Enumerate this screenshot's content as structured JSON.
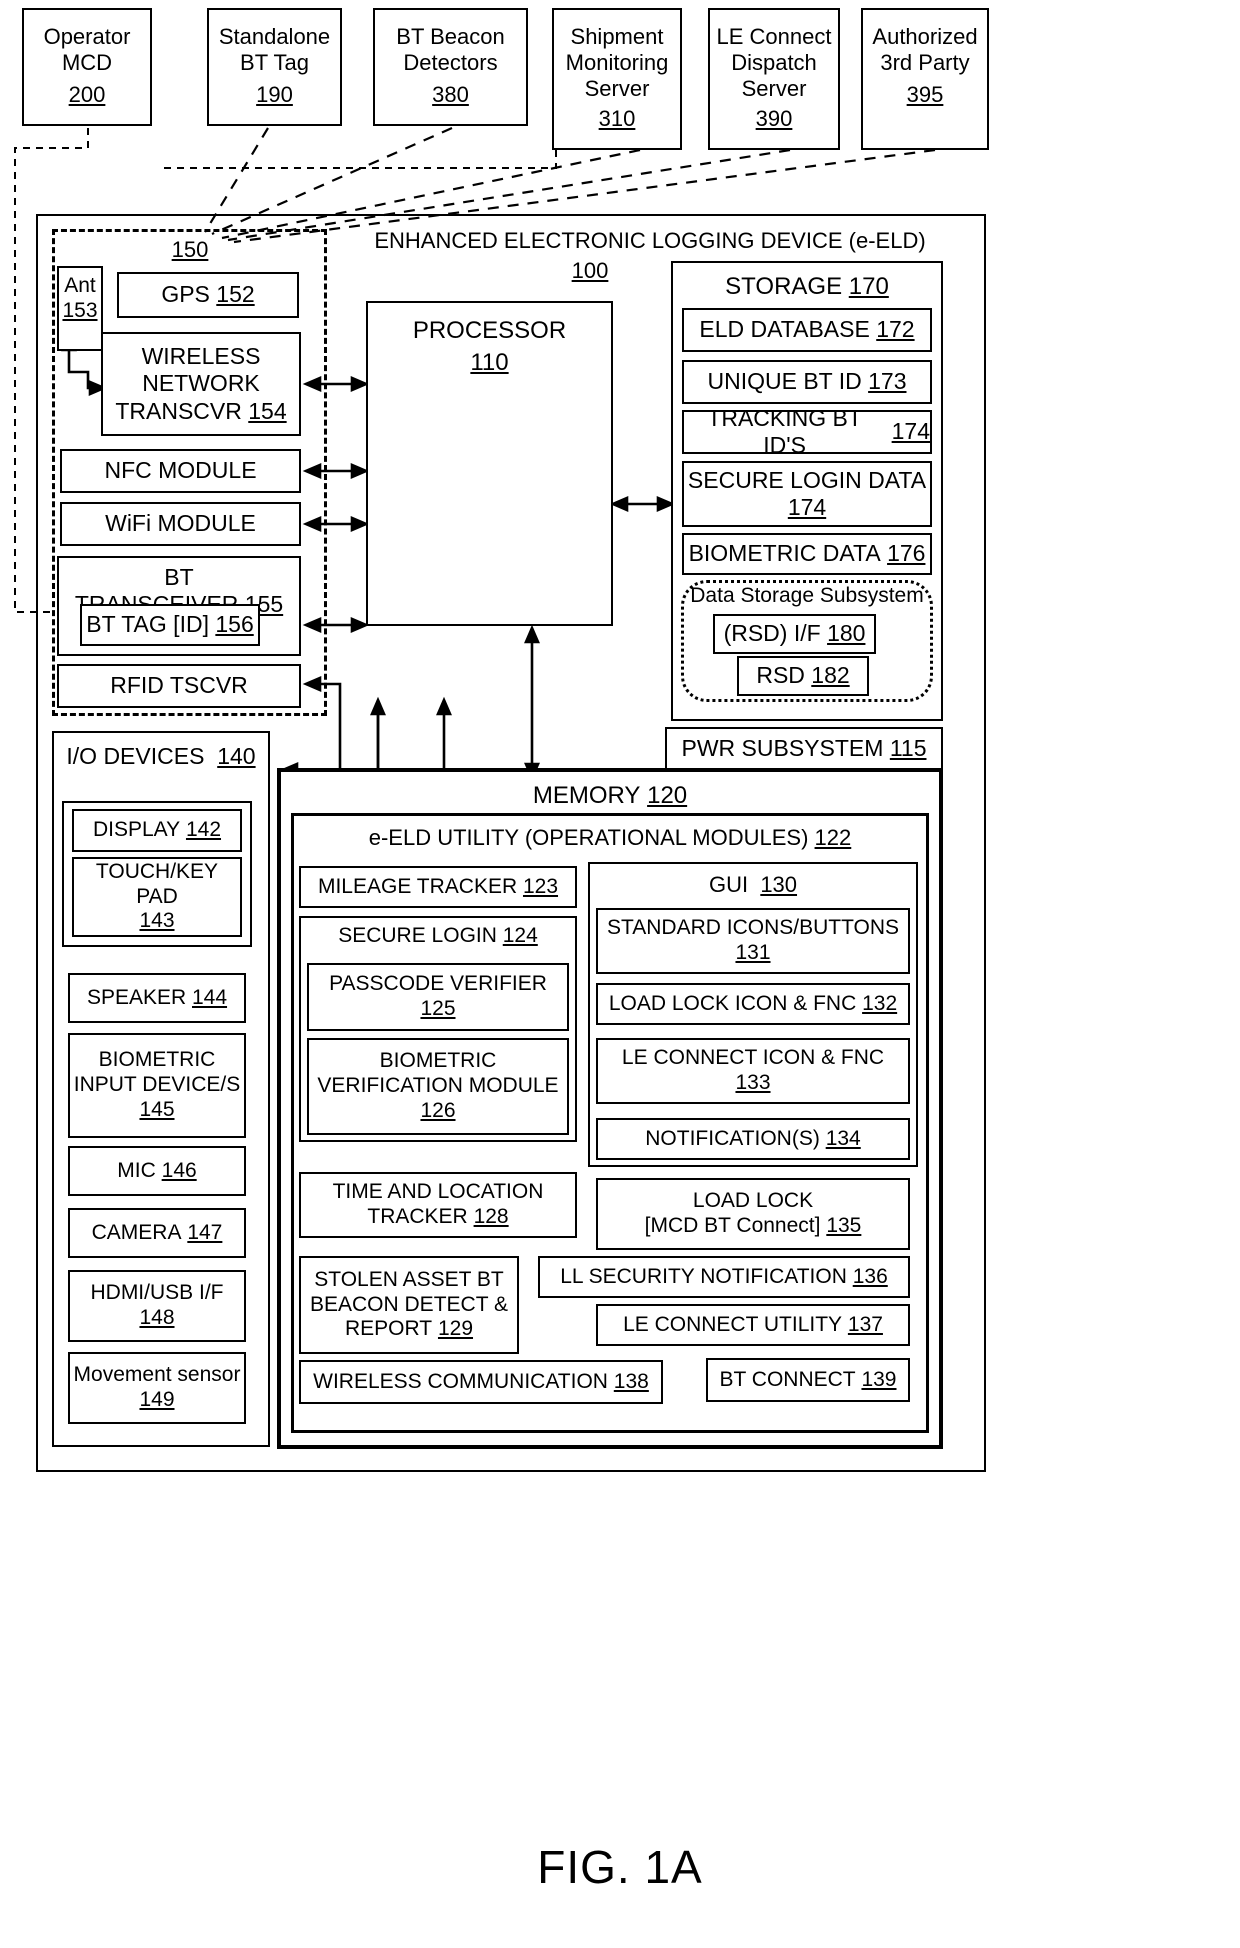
{
  "figure": {
    "caption": "FIG. 1A"
  },
  "external_nodes": [
    {
      "lines": [
        "Operator",
        "MCD"
      ],
      "ref": "200"
    },
    {
      "lines": [
        "Standalone",
        "BT Tag"
      ],
      "ref": "190"
    },
    {
      "lines": [
        "BT Beacon",
        "Detectors"
      ],
      "ref": "380"
    },
    {
      "lines": [
        "Shipment",
        "Monitoring",
        "Server"
      ],
      "ref": "310"
    },
    {
      "lines": [
        "LE Connect",
        "Dispatch",
        "Server"
      ],
      "ref": "390"
    },
    {
      "lines": [
        "Authorized",
        "3rd Party"
      ],
      "ref": "395"
    }
  ],
  "device": {
    "title": "ENHANCED ELECTRONIC LOGGING DEVICE (e-ELD)",
    "ref": "100"
  },
  "comms_group": {
    "ref": "150"
  },
  "comms": {
    "antenna": {
      "label": "Ant",
      "ref": "153"
    },
    "gps": {
      "label": "GPS",
      "ref": "152"
    },
    "wireless_network": {
      "lines": [
        "WIRELESS",
        "NETWORK",
        "TRANSCVR"
      ],
      "ref": "154"
    },
    "nfc": {
      "label": "NFC MODULE",
      "ref": ""
    },
    "wifi": {
      "label": "WiFi MODULE",
      "ref": ""
    },
    "bt_transceiver": {
      "label": "BT TRANSCEIVER",
      "ref": "155"
    },
    "bt_tag": {
      "label": "BT TAG [ID]",
      "ref": "156"
    },
    "rfid": {
      "label": "RFID TSCVR",
      "ref": ""
    }
  },
  "processor": {
    "label": "PROCESSOR",
    "ref": "110"
  },
  "storage": {
    "title": "STORAGE",
    "ref": "170",
    "items": [
      {
        "label": "ELD DATABASE",
        "ref": "172"
      },
      {
        "label": "UNIQUE BT ID",
        "ref": "173"
      },
      {
        "label": "TRACKING BT ID'S",
        "ref": "174"
      },
      {
        "label": "SECURE LOGIN DATA",
        "ref": "174",
        "two_line": true
      },
      {
        "label": "BIOMETRIC DATA",
        "ref": "176"
      }
    ],
    "subsystem": {
      "title": "Data Storage Subsystem",
      "rsd_if": {
        "label": "(RSD) I/F",
        "ref": "180"
      },
      "rsd": {
        "label": "RSD",
        "ref": "182"
      }
    }
  },
  "power": {
    "label": "PWR SUBSYSTEM",
    "ref": "115"
  },
  "io": {
    "title": "I/O DEVICES",
    "ref": "140",
    "display": {
      "label": "DISPLAY",
      "ref": "142"
    },
    "touch": {
      "label": "TOUCH/KEY PAD",
      "ref": "143",
      "two_line": true
    },
    "items": [
      {
        "label": "SPEAKER",
        "ref": "144"
      },
      {
        "label": "BIOMETRIC INPUT DEVICE/S",
        "ref": "145",
        "lines": [
          "BIOMETRIC",
          "INPUT DEVICE/S"
        ]
      },
      {
        "label": "MIC",
        "ref": "146"
      },
      {
        "label": "CAMERA",
        "ref": "147"
      },
      {
        "label": "HDMI/USB I/F",
        "ref": "148",
        "two_line": true
      },
      {
        "label": "Movement sensor",
        "ref": "149",
        "two_line": true
      }
    ]
  },
  "memory": {
    "title": "MEMORY",
    "ref": "120",
    "utility": {
      "title": "e-ELD UTILITY (OPERATIONAL MODULES)",
      "ref": "122",
      "left_modules": [
        {
          "label": "MILEAGE TRACKER",
          "ref": "123"
        },
        {
          "label": "SECURE LOGIN",
          "ref": "124"
        },
        {
          "label": "PASSCODE VERIFIER",
          "ref": "125",
          "two_line": true
        },
        {
          "label": "BIOMETRIC VERIFICATION MODULE",
          "ref": "126",
          "lines": [
            "BIOMETRIC",
            "VERIFICATION MODULE"
          ]
        },
        {
          "label": "TIME AND LOCATION TRACKER",
          "ref": "128",
          "lines": [
            "TIME AND LOCATION",
            "TRACKER"
          ]
        },
        {
          "label": "STOLEN ASSET BT BEACON DETECT & REPORT",
          "ref": "129",
          "lines": [
            "STOLEN ASSET BT",
            "BEACON DETECT &",
            "REPORT"
          ]
        }
      ],
      "gui": {
        "title": "GUI",
        "ref": "130",
        "items": [
          {
            "label": "STANDARD ICONS/BUTTONS",
            "ref": "131",
            "two_line": true
          },
          {
            "label": "LOAD LOCK ICON & FNC",
            "ref": "132"
          },
          {
            "label": "LE CONNECT ICON & FNC",
            "ref": "133",
            "two_line": true
          },
          {
            "label": "NOTIFICATION(S)",
            "ref": "134"
          }
        ]
      },
      "right_modules": [
        {
          "label": "LOAD LOCK [MCD BT Connect]",
          "ref": "135",
          "lines": [
            "LOAD LOCK",
            "[MCD BT Connect]"
          ]
        },
        {
          "label": "LL SECURITY NOTIFICATION",
          "ref": "136"
        },
        {
          "label": "LE CONNECT UTILITY",
          "ref": "137"
        }
      ],
      "bottom": [
        {
          "label": "WIRELESS COMMUNICATION",
          "ref": "138"
        },
        {
          "label": "BT CONNECT",
          "ref": "139"
        }
      ]
    }
  }
}
